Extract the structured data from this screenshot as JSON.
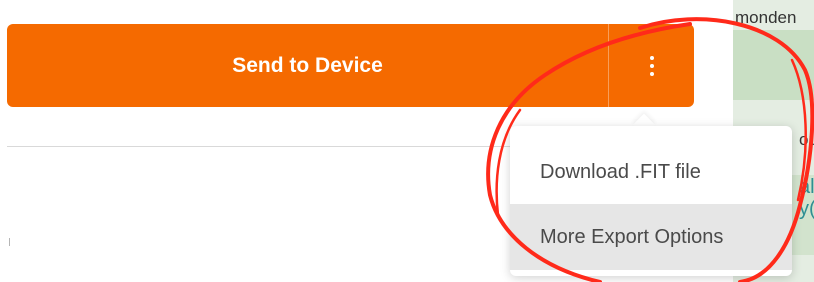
{
  "send_button": {
    "label": "Send to Device",
    "more_icon": "more-vertical-icon",
    "color": "#f56a00"
  },
  "dropdown_menu": {
    "items": [
      {
        "label": "Download .FIT file"
      },
      {
        "label": "More Export Options"
      }
    ],
    "highlight_color": "#e6e6e6"
  },
  "map": {
    "labels": [
      "monden",
      "ou",
      "al",
      "y("
    ]
  },
  "annotation": {
    "shape": "hand-drawn circle",
    "color": "#ff2a1a"
  }
}
